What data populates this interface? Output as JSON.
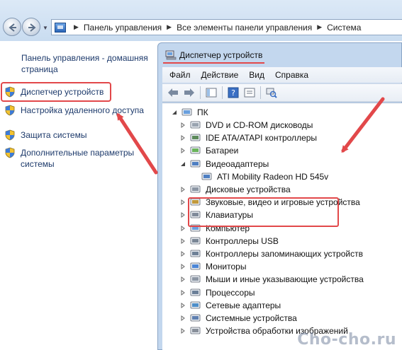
{
  "address_bar": {
    "breadcrumbs": [
      "Панель управления",
      "Все элементы панели управления",
      "Система"
    ]
  },
  "left_pane": {
    "home_link": "Панель управления - домашняя страница",
    "tasks": [
      {
        "label": "Диспетчер устройств",
        "icon": "uac-shield-icon"
      },
      {
        "label": "Настройка удаленного доступа",
        "icon": "uac-shield-icon"
      },
      {
        "label": "Защита системы",
        "icon": "uac-shield-icon"
      },
      {
        "label": "Дополнительные параметры системы",
        "icon": "uac-shield-icon"
      }
    ]
  },
  "device_manager": {
    "title": "Диспетчер устройств",
    "menu": [
      "Файл",
      "Действие",
      "Вид",
      "Справка"
    ],
    "root": "ПК",
    "categories": [
      {
        "label": "DVD и CD-ROM дисководы",
        "icon": "dvd-drive-icon"
      },
      {
        "label": "IDE ATA/ATAPI контроллеры",
        "icon": "ide-controller-icon"
      },
      {
        "label": "Батареи",
        "icon": "battery-icon"
      },
      {
        "label": "Видеоадаптеры",
        "icon": "display-adapter-icon",
        "expanded": true,
        "children": [
          {
            "label": "ATI Mobility Radeon HD 545v",
            "icon": "display-adapter-icon"
          }
        ]
      },
      {
        "label": "Дисковые устройства",
        "icon": "disk-drive-icon"
      },
      {
        "label": "Звуковые, видео и игровые устройства",
        "icon": "sound-icon"
      },
      {
        "label": "Клавиатуры",
        "icon": "keyboard-icon"
      },
      {
        "label": "Компьютер",
        "icon": "computer-icon"
      },
      {
        "label": "Контроллеры USB",
        "icon": "usb-icon"
      },
      {
        "label": "Контроллеры запоминающих устройств",
        "icon": "storage-controller-icon"
      },
      {
        "label": "Мониторы",
        "icon": "monitor-icon"
      },
      {
        "label": "Мыши и иные указывающие устройства",
        "icon": "mouse-icon"
      },
      {
        "label": "Процессоры",
        "icon": "processor-icon"
      },
      {
        "label": "Сетевые адаптеры",
        "icon": "network-adapter-icon"
      },
      {
        "label": "Системные устройства",
        "icon": "system-devices-icon"
      },
      {
        "label": "Устройства обработки изображений",
        "icon": "imaging-device-icon"
      }
    ]
  },
  "watermark": "Cho-cho.ru",
  "colors": {
    "annotation_red": "#e2484a",
    "link_blue": "#1d3a6b",
    "window_frame": "#c3d7ee"
  }
}
